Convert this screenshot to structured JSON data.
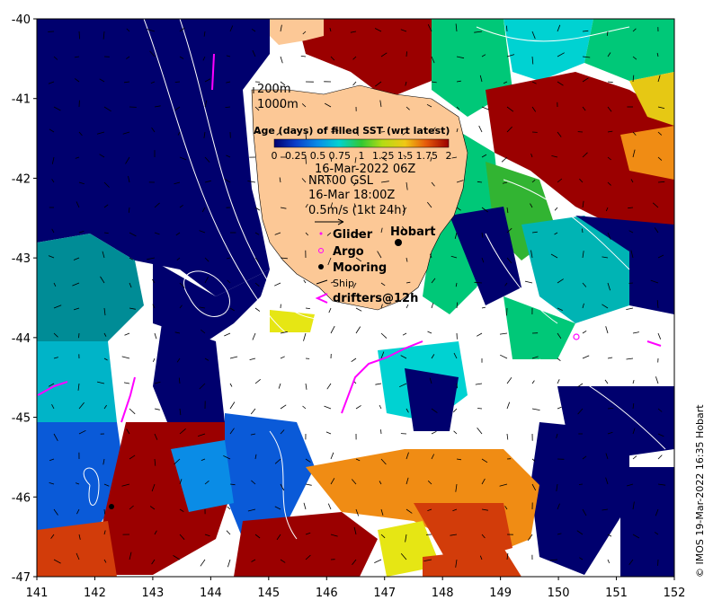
{
  "map": {
    "x_ticks": [
      "141",
      "142",
      "143",
      "144",
      "145",
      "146",
      "147",
      "148",
      "149",
      "150",
      "151",
      "152"
    ],
    "y_ticks": [
      "-40",
      "-41",
      "-42",
      "-43",
      "-44",
      "-45",
      "-46",
      "-47"
    ],
    "lon_range": [
      141,
      152
    ],
    "lat_range": [
      -47,
      -40
    ]
  },
  "legend": {
    "isobath_200": "200m",
    "isobath_1000": "1000m",
    "colorbar_title": "Age (days) of filled SST (wrt latest)",
    "colorbar_ticks": [
      "0",
      "0.25",
      "0.5",
      "0.75",
      "1",
      "1.25",
      "1.5",
      "1.75",
      "2"
    ],
    "date": "16-Mar-2022 06Z",
    "product": "NRT00 GSL",
    "product_time": "16-Mar 18:00Z",
    "scale": "0.5m/s (1kt 24h)",
    "glider": "Glider",
    "argo": "Argo",
    "mooring": "Mooring",
    "ship": "Ship",
    "drifters": "drifters@12h",
    "city": "Hobart"
  },
  "credit": "© IMOS 19-Mar-2022 16:35 Hobart",
  "colors": {
    "age0": "#00006e",
    "age025": "#0a5ad8",
    "age05": "#00d2d2",
    "age075": "#00c878",
    "age1": "#32b432",
    "age125": "#e6e614",
    "age15": "#f08c14",
    "age175": "#d23c0a",
    "age2": "#9b0000",
    "land": "#fcc896",
    "drifter": "#ff00ff"
  }
}
